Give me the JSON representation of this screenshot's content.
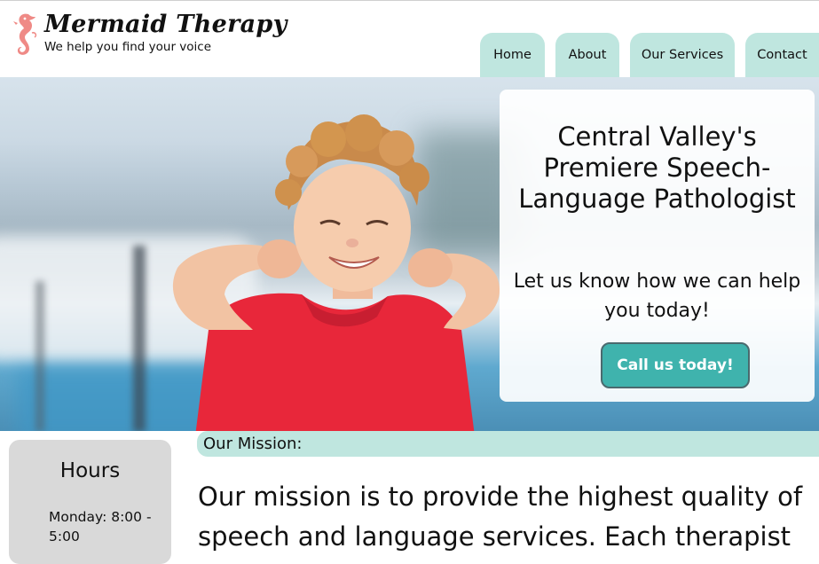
{
  "brand": {
    "name": "Mermaid Therapy",
    "tagline": "We help you find your voice",
    "logo_icon": "seahorse-icon",
    "logo_color": "#ef8a86"
  },
  "nav": {
    "items": [
      {
        "label": "Home"
      },
      {
        "label": "About"
      },
      {
        "label": "Our Services"
      },
      {
        "label": "Contact"
      }
    ],
    "tab_color": "#bfe6df"
  },
  "hero": {
    "heading": "Central Valley's Premiere Speech-Language Pathologist",
    "subheading": "Let us know how we can help you today!",
    "cta_label": "Call us today!",
    "cta_color": "#3fb3ad",
    "image": "boy-flexing-photo"
  },
  "hours": {
    "title": "Hours",
    "monday": "Monday: 8:00 - 5:00"
  },
  "mission": {
    "label": "Our Mission:",
    "text": "Our mission is to provide the highest quality of speech and language services. Each therapist"
  }
}
